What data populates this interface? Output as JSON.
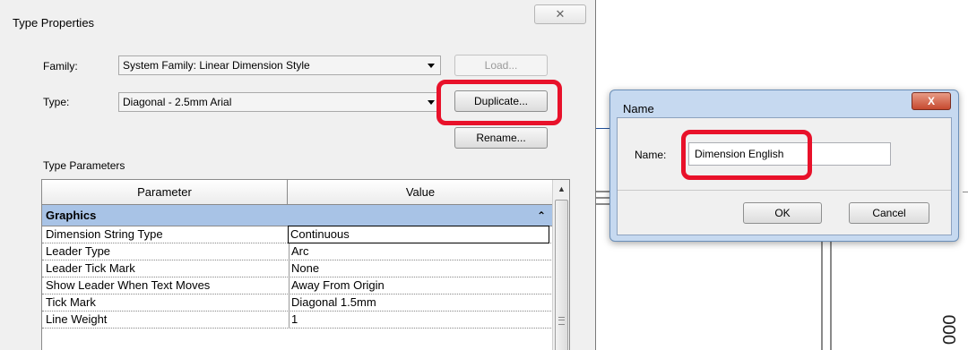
{
  "type_properties": {
    "title": "Type Properties",
    "close_glyph": "✕",
    "family_label": "Family:",
    "family_value": "System Family: Linear Dimension Style",
    "type_label": "Type:",
    "type_value": "Diagonal - 2.5mm Arial",
    "load_button": "Load...",
    "duplicate_button": "Duplicate...",
    "rename_button": "Rename...",
    "type_parameters_label": "Type Parameters",
    "columns": {
      "parameter": "Parameter",
      "value": "Value"
    },
    "group": {
      "name": "Graphics",
      "collapse_icon": "chevrons-up-icon"
    },
    "rows": [
      {
        "name": "Dimension String Type",
        "value": "Continuous"
      },
      {
        "name": "Leader Type",
        "value": "Arc"
      },
      {
        "name": "Leader Tick Mark",
        "value": "None"
      },
      {
        "name": "Show Leader When Text Moves",
        "value": "Away From Origin"
      },
      {
        "name": "Tick Mark",
        "value": "Diagonal 1.5mm"
      },
      {
        "name": "Line Weight",
        "value": "1"
      }
    ]
  },
  "name_dialog": {
    "title": "Name",
    "close_glyph": "X",
    "name_label": "Name:",
    "name_value": "Dimension English",
    "ok_button": "OK",
    "cancel_button": "Cancel"
  },
  "background": {
    "dimension_text": "000"
  },
  "colors": {
    "highlight": "#e8112a",
    "group_row": "#a8c3e6",
    "name_frame": "#c6d9f0"
  }
}
